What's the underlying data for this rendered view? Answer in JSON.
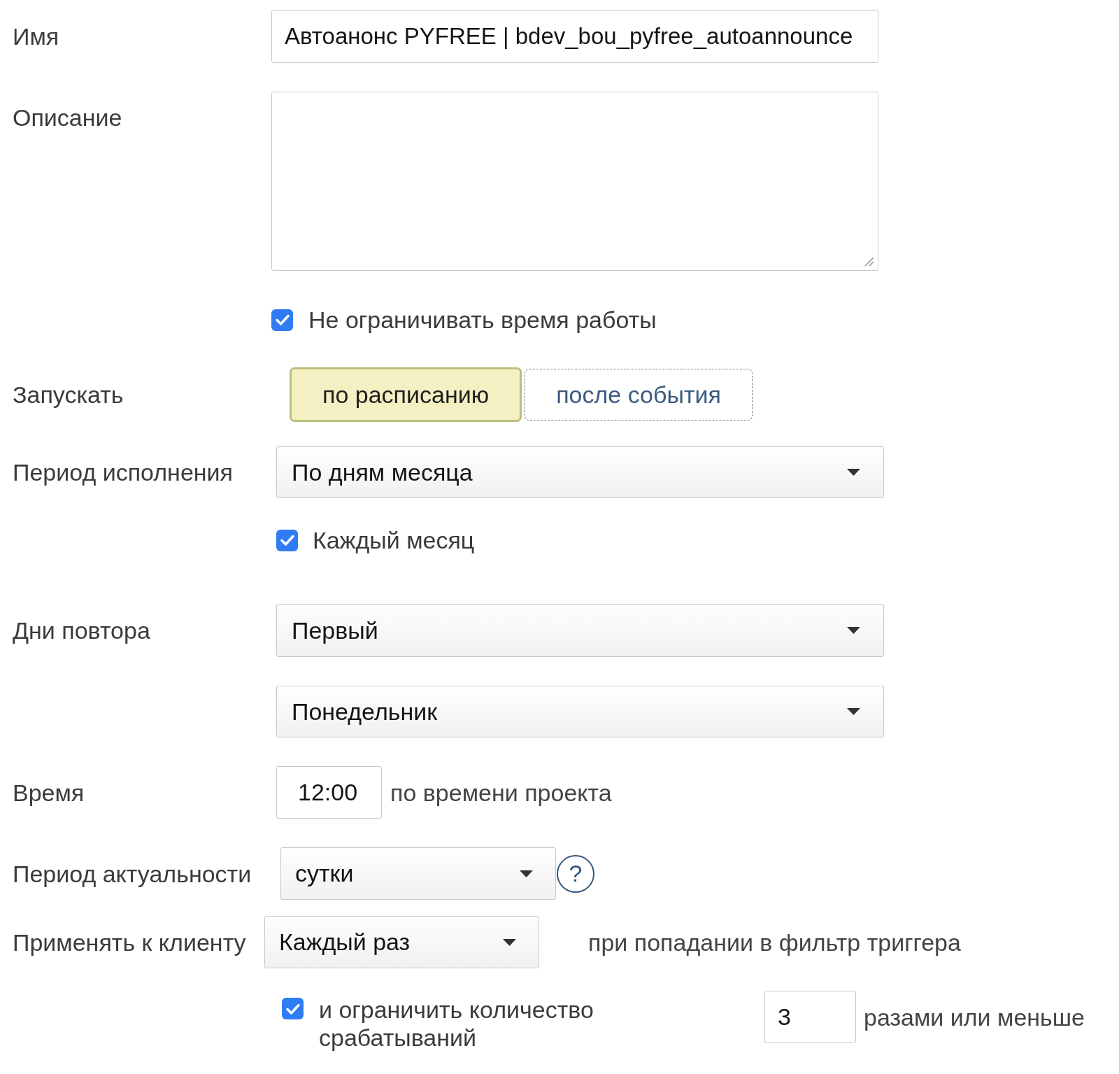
{
  "name_field": {
    "label": "Имя",
    "value": "Автоанонс PYFREE | bdev_bou_pyfree_autoannounce"
  },
  "description_field": {
    "label": "Описание"
  },
  "unlimited_time": {
    "label": "Не ограничивать время работы",
    "checked": true
  },
  "launch": {
    "label": "Запускать",
    "options": [
      {
        "label": "по расписанию",
        "selected": true
      },
      {
        "label": "после события",
        "selected": false
      }
    ]
  },
  "execution_period": {
    "label": "Период исполнения",
    "value": "По дням месяца"
  },
  "every_month": {
    "label": "Каждый месяц",
    "checked": true
  },
  "repeat_days": {
    "label": "Дни повтора",
    "values": [
      "Первый",
      "Понедельник"
    ]
  },
  "time": {
    "label": "Время",
    "value": "12:00",
    "suffix": "по времени проекта"
  },
  "relevance_period": {
    "label": "Период актуальности",
    "value": "сутки",
    "help": "?"
  },
  "apply_to_client": {
    "label": "Применять к клиенту",
    "value": "Каждый раз",
    "suffix": "при попадании в фильтр триггера"
  },
  "limit": {
    "label": "и ограничить количество срабатываний",
    "checked": true,
    "value": "3",
    "suffix": "разами или меньше"
  }
}
